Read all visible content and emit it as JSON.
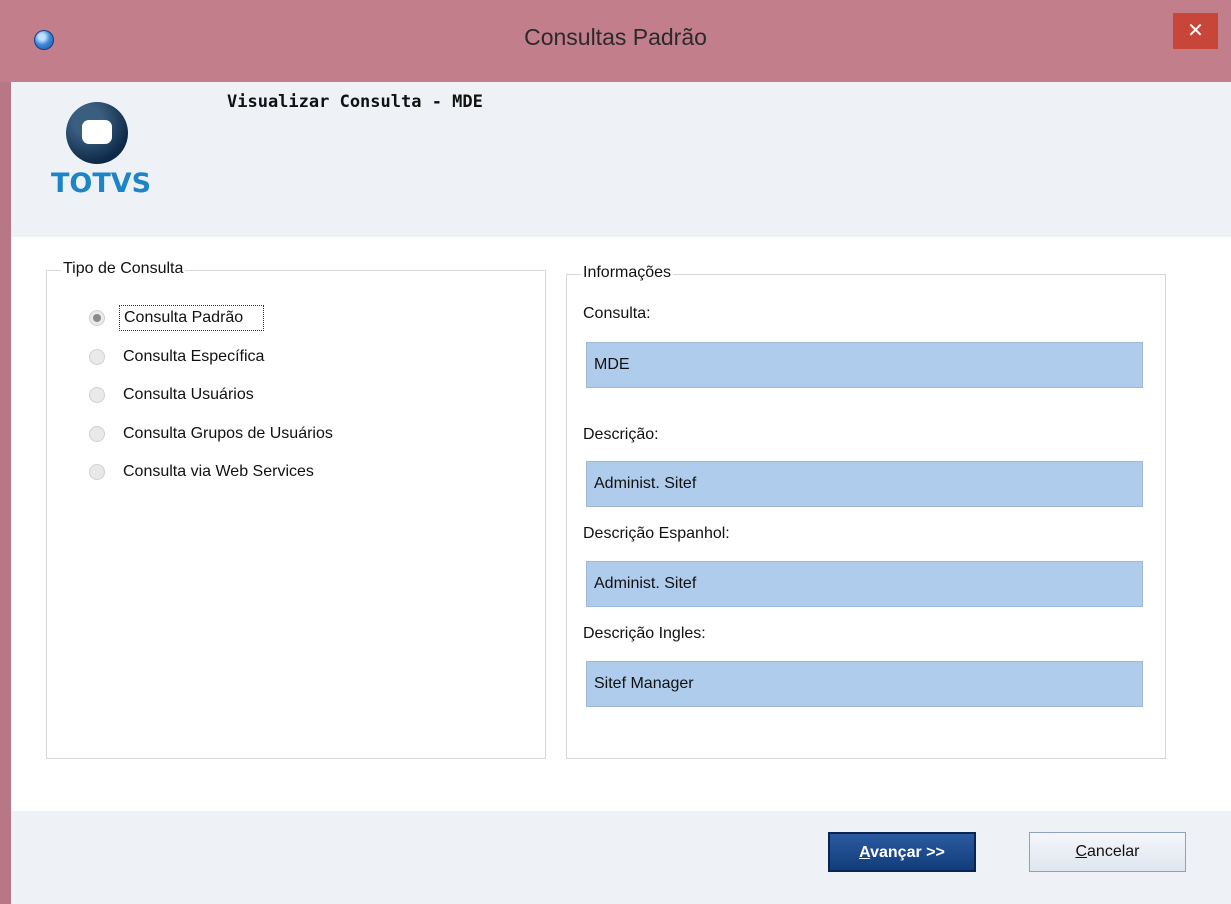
{
  "window": {
    "title": "Consultas Padrão",
    "close_label": "✕"
  },
  "header": {
    "title": "Visualizar Consulta - MDE",
    "logo_text": "TOTVS"
  },
  "tipo_consulta": {
    "legend": "Tipo de Consulta",
    "options": [
      {
        "label": "Consulta Padrão",
        "checked": true
      },
      {
        "label": "Consulta Específica",
        "checked": false
      },
      {
        "label": "Consulta Usuários",
        "checked": false
      },
      {
        "label": "Consulta Grupos de Usuários",
        "checked": false
      },
      {
        "label": "Consulta via Web Services",
        "checked": false
      }
    ]
  },
  "informacoes": {
    "legend": "Informações",
    "fields": [
      {
        "label": "Consulta:",
        "value": "MDE"
      },
      {
        "label": "Descrição:",
        "value": "Administ. Sitef"
      },
      {
        "label": "Descrição Espanhol:",
        "value": "Administ. Sitef"
      },
      {
        "label": "Descrição Ingles:",
        "value": "Sitef Manager"
      }
    ]
  },
  "footer": {
    "next_accel": "A",
    "next_rest": "vançar >>",
    "cancel_accel": "C",
    "cancel_rest": "ancelar"
  },
  "colors": {
    "titlebar": "#c27e8b",
    "close": "#c8453a",
    "field_bg": "#b0ccec",
    "primary_button": "#123d7c",
    "logo_text": "#1d84c6"
  }
}
